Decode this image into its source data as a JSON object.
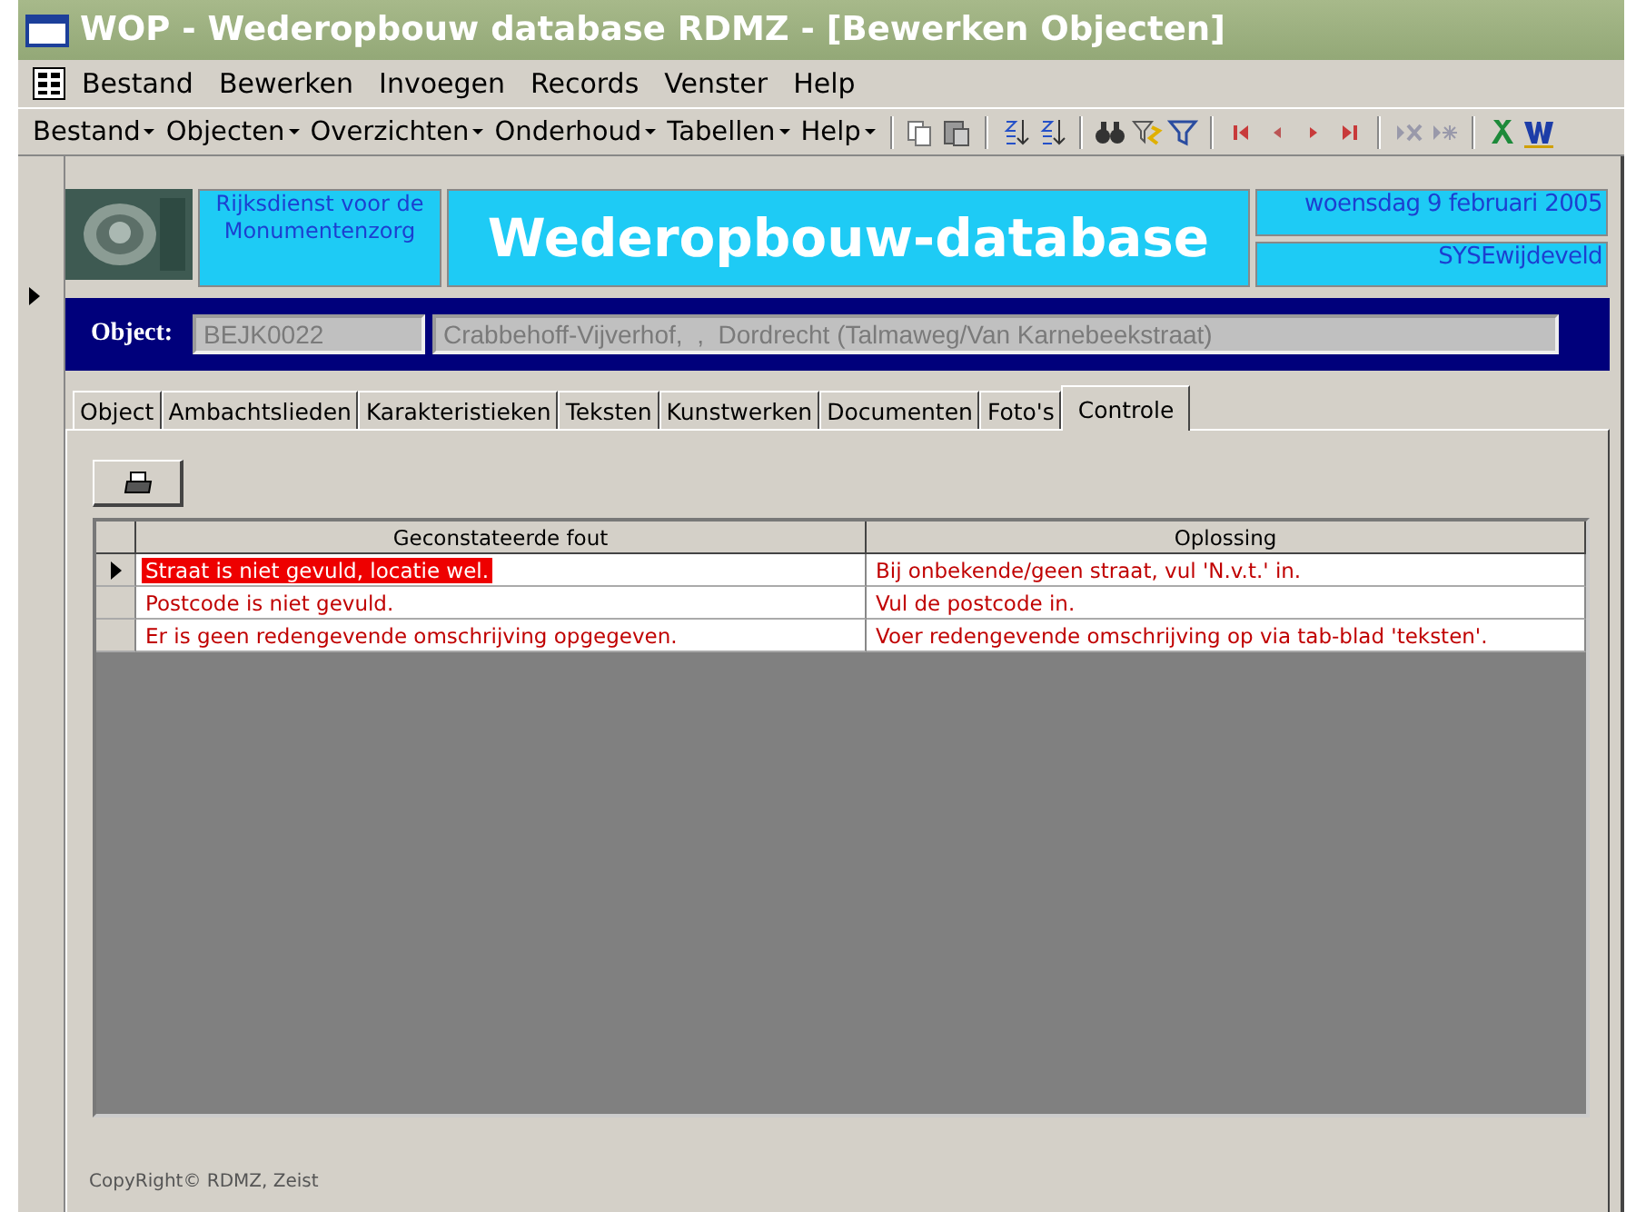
{
  "window": {
    "title": "WOP - Wederopbouw database RDMZ - [Bewerken Objecten]"
  },
  "menu_bar": [
    "Bestand",
    "Bewerken",
    "Invoegen",
    "Records",
    "Venster",
    "Help"
  ],
  "toolbar": {
    "menus": [
      "Bestand",
      "Objecten",
      "Overzichten",
      "Onderhoud",
      "Tabellen",
      "Help"
    ]
  },
  "header": {
    "organization": "Rijksdienst voor de Monumentenzorg",
    "title": "Wederopbouw-database",
    "date": "woensdag 9 februari 2005",
    "user": "SYSEwijdeveld"
  },
  "object": {
    "label": "Object:",
    "code": "BEJK0022",
    "description": "Crabbehoff-Vijverhof,  ,  Dordrecht (Talmaweg/Van Karnebeekstraat)"
  },
  "tabs": [
    {
      "label": "Object",
      "selected": false
    },
    {
      "label": "Ambachtslieden",
      "selected": false
    },
    {
      "label": "Karakteristieken",
      "selected": false
    },
    {
      "label": "Teksten",
      "selected": false
    },
    {
      "label": "Kunstwerken",
      "selected": false
    },
    {
      "label": "Documenten",
      "selected": false
    },
    {
      "label": "Foto's",
      "selected": false
    },
    {
      "label": "Controle",
      "selected": true
    }
  ],
  "grid": {
    "columns": [
      "Geconstateerde fout",
      "Oplossing"
    ],
    "rows": [
      {
        "cells": [
          "Straat is niet gevuld, locatie wel.",
          "Bij onbekende/geen straat, vul 'N.v.t.' in."
        ],
        "selected": true
      },
      {
        "cells": [
          "Postcode is niet gevuld.",
          "Vul de postcode in."
        ],
        "selected": false
      },
      {
        "cells": [
          "Er is geen redengevende omschrijving opgegeven.",
          "Voer redengevende omschrijving op via tab-blad 'teksten'."
        ],
        "selected": false
      }
    ]
  },
  "footer": "CopyRight© RDMZ, Zeist"
}
